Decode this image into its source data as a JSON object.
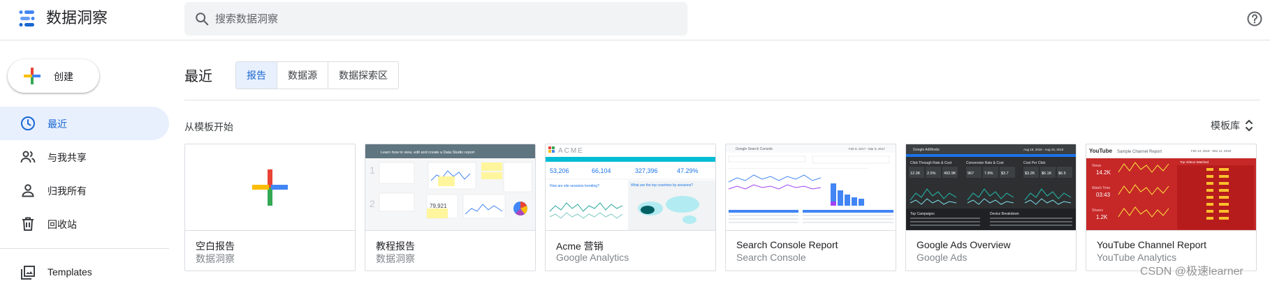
{
  "header": {
    "app_title": "数据洞察",
    "logo_icon": "data-studio-logo-icon",
    "search": {
      "placeholder": "搜索数据洞察",
      "value": ""
    },
    "help_icon": "help-icon"
  },
  "sidebar": {
    "create_label": "创建",
    "items": [
      {
        "label": "最近",
        "icon": "clock-icon",
        "active": true
      },
      {
        "label": "与我共享",
        "icon": "people-icon",
        "active": false
      },
      {
        "label": "归我所有",
        "icon": "person-icon",
        "active": false
      },
      {
        "label": "回收站",
        "icon": "trash-icon",
        "active": false
      },
      {
        "label": "Templates",
        "icon": "templates-icon",
        "active": false
      }
    ]
  },
  "main": {
    "section_title": "最近",
    "tabs": [
      {
        "label": "报告",
        "active": true
      },
      {
        "label": "数据源",
        "active": false
      },
      {
        "label": "数据探索区",
        "active": false
      }
    ],
    "templates_heading": "从模板开始",
    "gallery_link": "模板库",
    "cards": [
      {
        "title": "空白报告",
        "subtitle": "数据洞察"
      },
      {
        "title": "教程报告",
        "subtitle": "数据洞察",
        "thumb": {
          "banner": "Learn how to view, edit and create a Data Studio report",
          "step1": "1",
          "step2": "2",
          "value": "79,921"
        }
      },
      {
        "title": "Acme 营销",
        "subtitle": "Google Analytics",
        "thumb": {
          "brand": "ACME",
          "kpis": [
            "53,206",
            "66,104",
            "327,396",
            "47.29%"
          ],
          "q1": "How are site sessions trending?",
          "q2": "What are the top countries by sessions?"
        }
      },
      {
        "title": "Search Console Report",
        "subtitle": "Search Console",
        "thumb": {
          "brand": "Google Search Console",
          "date": "Feb 9, 2017 - Mar 9, 2017"
        }
      },
      {
        "title": "Google Ads Overview",
        "subtitle": "Google Ads",
        "thumb": {
          "brand": "Google AdWords",
          "date": "Aug 19, 2016 - Aug 19, 2018",
          "heads": [
            "Click Through Rate & Cost",
            "Conversion Rate & Cost",
            "Cost Per Click"
          ],
          "kpis": [
            "12.3K",
            "2.5%",
            "492.9K",
            "967",
            "7.8%",
            "$3.7",
            "$3.2K",
            "$6.1K",
            "$6.5"
          ],
          "foot1": "Top Campaigns",
          "foot2": "Device Breakdown"
        }
      },
      {
        "title": "YouTube Channel Report",
        "subtitle": "YouTube Analytics",
        "thumb": {
          "brand": "YouTube",
          "heading": "Sample Channel Report",
          "date": "Feb 13, 2018 - Mar 12, 2018",
          "stats": [
            {
              "label": "Views",
              "value": "14.2K"
            },
            {
              "label": "Watch Time",
              "value": "03:43"
            },
            {
              "label": "Shares",
              "value": "1.2K"
            }
          ],
          "table_title": "Top Videos Watched"
        }
      }
    ]
  },
  "colors": {
    "accent_blue": "#1967d2",
    "active_bg": "#e8f0fe",
    "google_blue": "#4285f4",
    "google_red": "#ea4335",
    "google_yellow": "#fbbc04",
    "google_green": "#34a853"
  },
  "watermark": "CSDN @极速learner"
}
